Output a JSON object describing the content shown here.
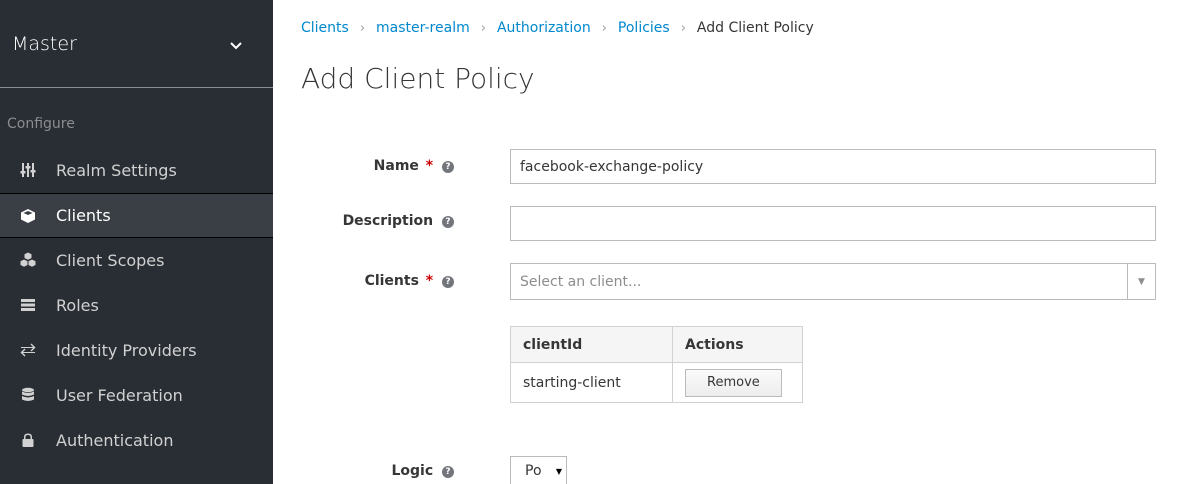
{
  "sidebar": {
    "realm": "Master",
    "section_label": "Configure",
    "items": [
      {
        "label": "Realm Settings",
        "icon": "sliders-icon"
      },
      {
        "label": "Clients",
        "icon": "cube-icon",
        "active": true
      },
      {
        "label": "Client Scopes",
        "icon": "cubes-icon"
      },
      {
        "label": "Roles",
        "icon": "list-icon"
      },
      {
        "label": "Identity Providers",
        "icon": "exchange-icon"
      },
      {
        "label": "User Federation",
        "icon": "database-icon"
      },
      {
        "label": "Authentication",
        "icon": "lock-icon"
      }
    ]
  },
  "breadcrumb": {
    "items": [
      "Clients",
      "master-realm",
      "Authorization",
      "Policies"
    ],
    "current": "Add Client Policy",
    "separator": "›"
  },
  "page_title": "Add Client Policy",
  "form": {
    "name": {
      "label": "Name",
      "required": "*",
      "value": "facebook-exchange-policy"
    },
    "description": {
      "label": "Description",
      "value": ""
    },
    "clients": {
      "label": "Clients",
      "required": "*",
      "placeholder": "Select an client..."
    },
    "table": {
      "headers": [
        "clientId",
        "Actions"
      ],
      "rows": [
        {
          "clientId": "starting-client",
          "action": "Remove"
        }
      ]
    },
    "logic": {
      "label": "Logic",
      "value": "Po"
    }
  },
  "help_glyph": "?",
  "colors": {
    "sidebar_bg": "#292e34",
    "link": "#0088ce",
    "required": "#cc0000"
  }
}
